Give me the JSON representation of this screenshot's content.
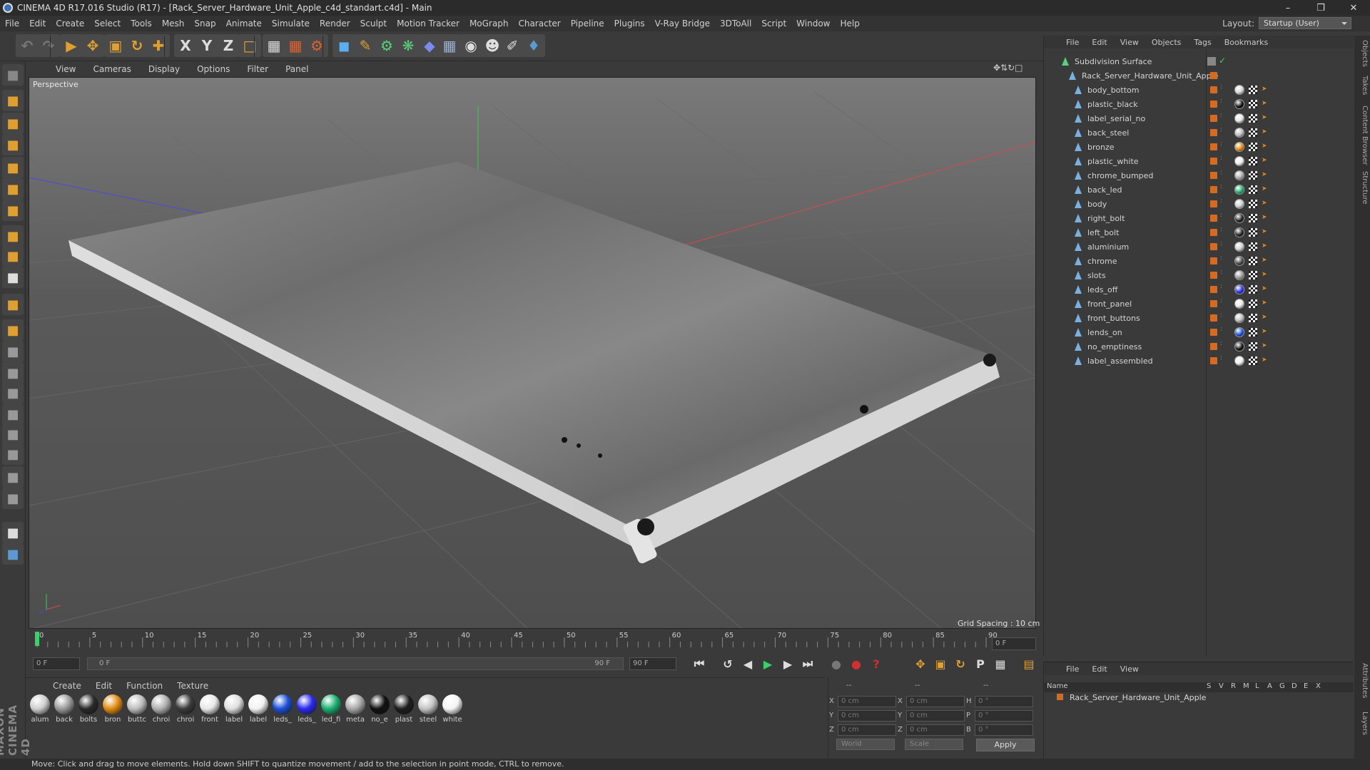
{
  "app": {
    "title": "CINEMA 4D R17.016 Studio (R17) - [Rack_Server_Hardware_Unit_Apple_c4d_standart.c4d] - Main",
    "window_controls": [
      "minimize-icon",
      "restore-icon",
      "close-icon"
    ]
  },
  "menu": [
    "File",
    "Edit",
    "Create",
    "Select",
    "Tools",
    "Mesh",
    "Snap",
    "Animate",
    "Simulate",
    "Render",
    "Sculpt",
    "Motion Tracker",
    "MoGraph",
    "Character",
    "Pipeline",
    "Plugins",
    "V-Ray Bridge",
    "3DToAll",
    "Script",
    "Window",
    "Help"
  ],
  "layout": {
    "label": "Layout:",
    "value": "Startup (User)"
  },
  "viewport": {
    "menu": [
      "View",
      "Cameras",
      "Display",
      "Options",
      "Filter",
      "Panel"
    ],
    "label": "Perspective",
    "grid_spacing": "Grid Spacing : 10 cm",
    "axis_labels": [
      "x",
      "y",
      "z"
    ]
  },
  "timeline": {
    "ticks": [
      "0",
      "5",
      "10",
      "15",
      "20",
      "25",
      "30",
      "35",
      "40",
      "45",
      "50",
      "55",
      "60",
      "65",
      "70",
      "75",
      "80",
      "85",
      "90"
    ],
    "current": "0 F",
    "start": "0 F",
    "slider_start": "0 F",
    "slider_end": "90 F",
    "end": "90 F"
  },
  "materials": {
    "menu": [
      "Create",
      "Edit",
      "Function",
      "Texture"
    ],
    "items": [
      {
        "label": "alum",
        "color": "#cfcfcf"
      },
      {
        "label": "back",
        "color": "#9a9a9a"
      },
      {
        "label": "bolts",
        "color": "#2a2a2a"
      },
      {
        "label": "bron",
        "color": "#e08a10"
      },
      {
        "label": "buttc",
        "color": "#bdbdbd"
      },
      {
        "label": "chroi",
        "color": "#b0b0b0"
      },
      {
        "label": "chroi",
        "color": "#3a3a3a"
      },
      {
        "label": "front",
        "color": "#e8e8e8"
      },
      {
        "label": "label",
        "color": "#dedede"
      },
      {
        "label": "label",
        "color": "#f2f2f2"
      },
      {
        "label": "leds_",
        "color": "#1a4fd8"
      },
      {
        "label": "leds_",
        "color": "#2a2af0"
      },
      {
        "label": "led_fi",
        "color": "#1ab070"
      },
      {
        "label": "meta",
        "color": "#a8a8a8"
      },
      {
        "label": "no_e",
        "color": "#111111"
      },
      {
        "label": "plast",
        "color": "#1e1e1e"
      },
      {
        "label": "steel",
        "color": "#c4c4c4"
      },
      {
        "label": "white",
        "color": "#f4f4f4"
      }
    ]
  },
  "coords": {
    "headers": [
      "--",
      "--",
      "--"
    ],
    "rows": [
      {
        "a": "X",
        "av": "0 cm",
        "b": "X",
        "bv": "0 cm",
        "c": "H",
        "cv": "0 °"
      },
      {
        "a": "Y",
        "av": "0 cm",
        "b": "Y",
        "bv": "0 cm",
        "c": "P",
        "cv": "0 °"
      },
      {
        "a": "Z",
        "av": "0 cm",
        "b": "Z",
        "bv": "0 cm",
        "c": "B",
        "cv": "0 °"
      }
    ],
    "world": "World",
    "scale": "Scale",
    "apply": "Apply"
  },
  "status": "Move: Click and drag to move elements. Hold down SHIFT to quantize movement / add to the selection in point mode, CTRL to remove.",
  "brand": "MAXON CINEMA 4D",
  "objects": {
    "menu": [
      "File",
      "Edit",
      "View",
      "Objects",
      "Tags",
      "Bookmarks"
    ],
    "root": "Subdivision Surface",
    "parent": "Rack_Server_Hardware_Unit_Apple",
    "children": [
      {
        "name": "body_bottom",
        "tag": "#d8d8d8"
      },
      {
        "name": "plastic_black",
        "tag": "#111111"
      },
      {
        "name": "label_serial_no",
        "tag": "#e6e6e6"
      },
      {
        "name": "back_steel",
        "tag": "#bbbbbb"
      },
      {
        "name": "bronze",
        "tag": "#e08a10"
      },
      {
        "name": "plastic_white",
        "tag": "#eeeeee"
      },
      {
        "name": "chrome_bumped",
        "tag": "#aaaaaa"
      },
      {
        "name": "back_led",
        "tag": "#1ab070"
      },
      {
        "name": "body",
        "tag": "#cccccc"
      },
      {
        "name": "right_bolt",
        "tag": "#222222"
      },
      {
        "name": "left_bolt",
        "tag": "#222222"
      },
      {
        "name": "aluminium",
        "tag": "#d0d0d0"
      },
      {
        "name": "chrome",
        "tag": "#444444"
      },
      {
        "name": "slots",
        "tag": "#999999"
      },
      {
        "name": "leds_off",
        "tag": "#2a2af0"
      },
      {
        "name": "front_panel",
        "tag": "#e8e8e8"
      },
      {
        "name": "front_buttons",
        "tag": "#c0c0c0"
      },
      {
        "name": "lends_on",
        "tag": "#1a4fd8"
      },
      {
        "name": "no_emptiness",
        "tag": "#111111"
      },
      {
        "name": "label_assembled",
        "tag": "#eeeeee"
      }
    ]
  },
  "attributes": {
    "menu": [
      "File",
      "Edit",
      "View"
    ],
    "columns": [
      "Name",
      "S",
      "V",
      "R",
      "M",
      "L",
      "A",
      "G",
      "D",
      "E",
      "X"
    ],
    "row": "Rack_Server_Hardware_Unit_Apple"
  },
  "side_tabs": [
    "Objects",
    "Takes",
    "Content Browser",
    "Structure",
    "Attributes",
    "Layers"
  ]
}
